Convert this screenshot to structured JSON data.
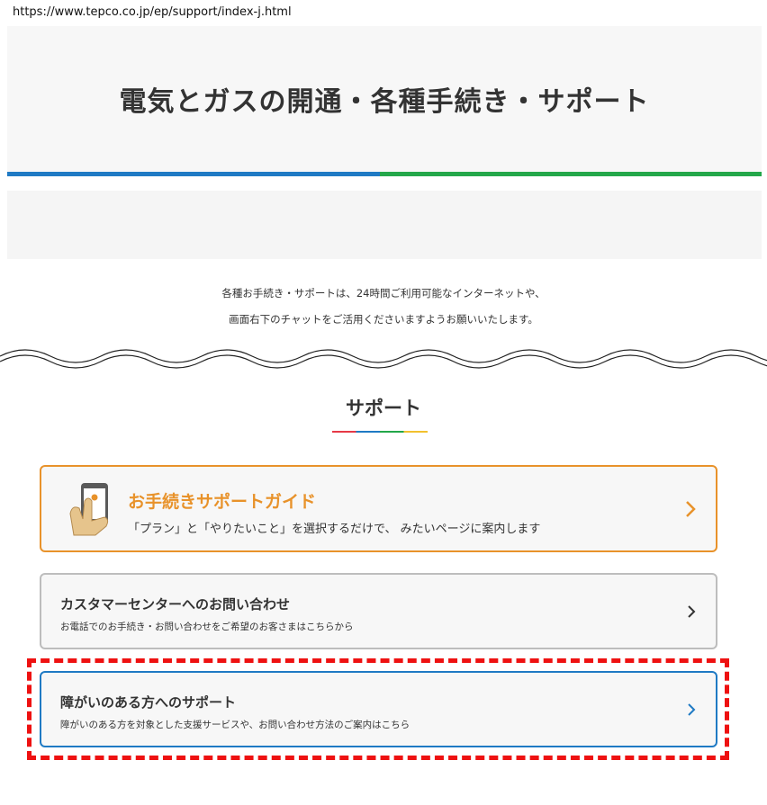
{
  "address_bar": {
    "url": "https://www.tepco.co.jp/ep/support/index-j.html"
  },
  "hero": {
    "title": "電気とガスの開通・各種手続き・サポート"
  },
  "colors": {
    "blue": "#1f7ac4",
    "green": "#23a74a",
    "orange": "#e8922a",
    "red_dash": "#ee1111"
  },
  "intro": {
    "line1": "各種お手続き・サポートは、24時間ご利用可能なインターネットや、",
    "line2": "画面右下のチャットをご活用くださいますようお願いいたします。"
  },
  "support": {
    "title": "サポート",
    "cards": [
      {
        "title": "お手続きサポートガイド",
        "subtitle": "「プラン」と「やりたいこと」を選択するだけで、 みたいページに案内します",
        "icon": "hand-smartphone-icon"
      },
      {
        "title": "カスタマーセンターへのお問い合わせ",
        "subtitle": "お電話でのお手続き・お問い合わせをご希望のお客さまはこちらから",
        "icon": "chevron-right-icon"
      },
      {
        "title": "障がいのある方へのサポート",
        "subtitle": "障がいのある方を対象とした支援サービスや、お問い合わせ方法のご案内はこちら",
        "icon": "chevron-right-icon"
      }
    ]
  }
}
